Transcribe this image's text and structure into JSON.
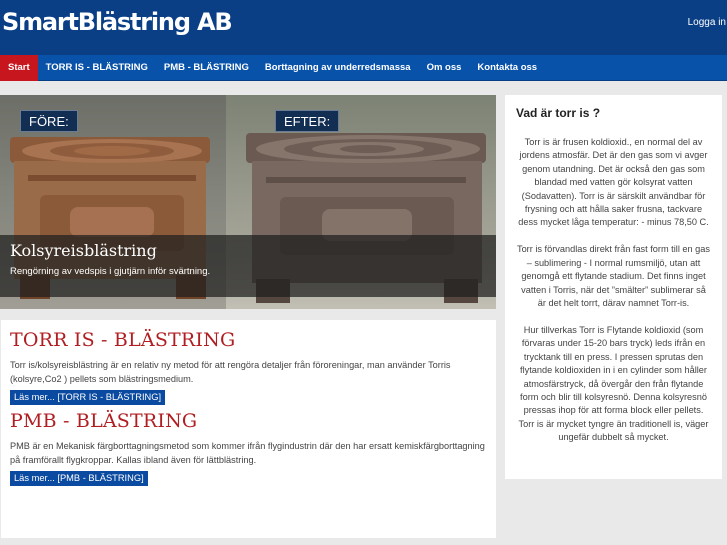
{
  "header": {
    "logo_text": "SmartBlästring AB",
    "login_label": "Logga in"
  },
  "nav": {
    "items": [
      {
        "label": "Start",
        "active": true
      },
      {
        "label": "TORR IS - BLÄSTRING"
      },
      {
        "label": "PMB - BLÄSTRING"
      },
      {
        "label": "Borttagning av underredsmassa"
      },
      {
        "label": "Om oss"
      },
      {
        "label": "Kontakta oss"
      }
    ]
  },
  "hero": {
    "before_label": "FÖRE:",
    "after_label": "EFTER:",
    "caption_title": "Kolsyreisblästring",
    "caption_subtitle": "Rengörning av vedspis i gjutjärn inför svärtning."
  },
  "main": {
    "sections": [
      {
        "heading": "TORR IS - BLÄSTRING",
        "text": "Torr is/kolsyreisblästring är en relativ ny metod för att rengöra detaljer från föroreningar, man använder Torris (kolsyre,Co2 ) pellets som blästringsmedium.",
        "button_label": "Läs mer... [TORR IS - BLÄSTRING]"
      },
      {
        "heading": "PMB - BLÄSTRING",
        "text": "PMB är en Mekanisk färgborttagningsmetod som kommer ifrån flygindustrin där den har ersatt kemiskfärgborttagning på framförallt flygkroppar. Kallas ibland även för lättblästring.",
        "button_label": "Läs mer... [PMB - BLÄSTRING]"
      }
    ]
  },
  "sidebar": {
    "title": "Vad är torr is ?",
    "paragraphs": [
      "Torr is är frusen koldioxid., en normal del av jordens atmosfär. Det är den gas som vi avger genom utandning. Det är också den gas som blandad med vatten gör kolsyrat vatten (Sodavatten). Torr is är särskilt användbar för frysning och att hålla saker frusna, tackvare dess mycket låga temperatur: - minus 78,50 C.",
      "Torr is förvandlas direkt från fast form till en gas – sublimering -  I normal rumsmiljö, utan att genomgå ett flytande stadium. Det finns inget vatten i Torris, när det ”smälter” sublimerar så är det helt torrt, därav namnet Torr-is.",
      "Hur tillverkas Torr is Flytande koldioxid (som förvaras under 15-20 bars tryck) leds ifrån en trycktank till en press. I pressen sprutas den flytande koldioxiden in i en cylinder som håller atmosfärstryck, då övergår den från flytande form och blir till kolsyresnö. Denna kolsyresnö pressas ihop för att forma block eller pellets. Torr is är mycket tyngre än traditionell is, väger ungefär dubbelt så mycket."
    ]
  },
  "colors": {
    "header_bg": "#0a3f86",
    "nav_bg": "#0852aa",
    "nav_active": "#c8161e",
    "heading_red": "#b01e22",
    "button_blue": "#0b4aa1"
  }
}
